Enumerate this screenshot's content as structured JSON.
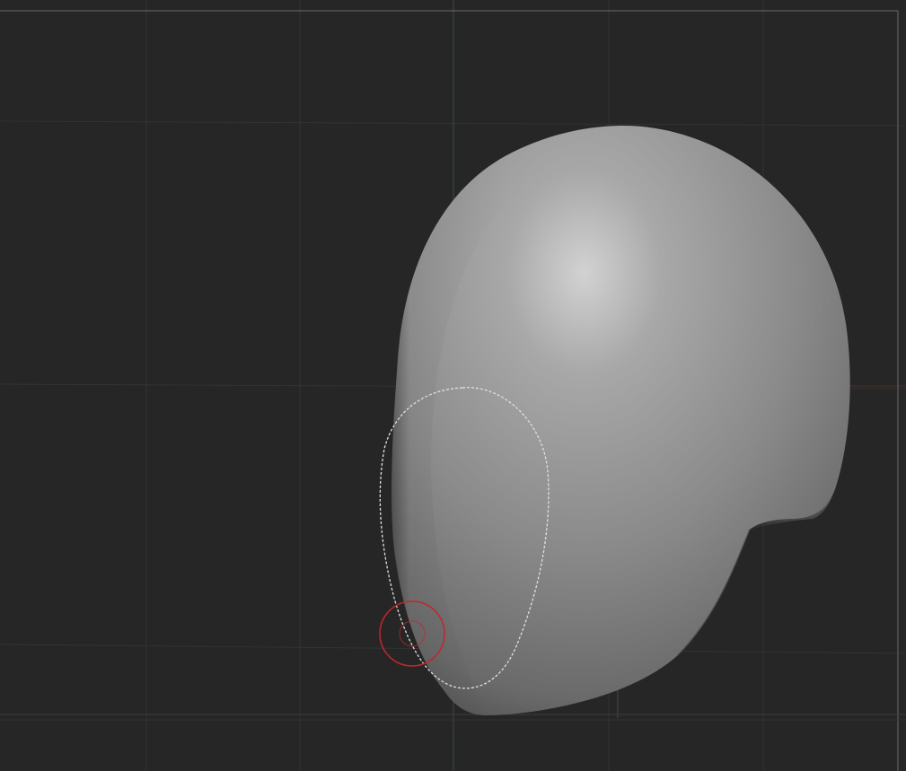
{
  "viewport": {
    "background": "#262626",
    "grid_color": "#353535",
    "axis_y_color": "#3d5a3d",
    "axis_x_color": "#6a2e2e",
    "frame_color": "#5a5a5a"
  },
  "model": {
    "type": "head-sculpt",
    "shading": "grey-clay",
    "base_color": "#8a8a8a",
    "highlight_color": "#d0d0d0",
    "shadow_color": "#4a4a4a"
  },
  "selection": {
    "shape": "lasso-ellipse",
    "style": "dashed",
    "color": "#d8d8d8"
  },
  "brush_cursor": {
    "color": "#c0272d",
    "inner_color": "#c0272d"
  }
}
